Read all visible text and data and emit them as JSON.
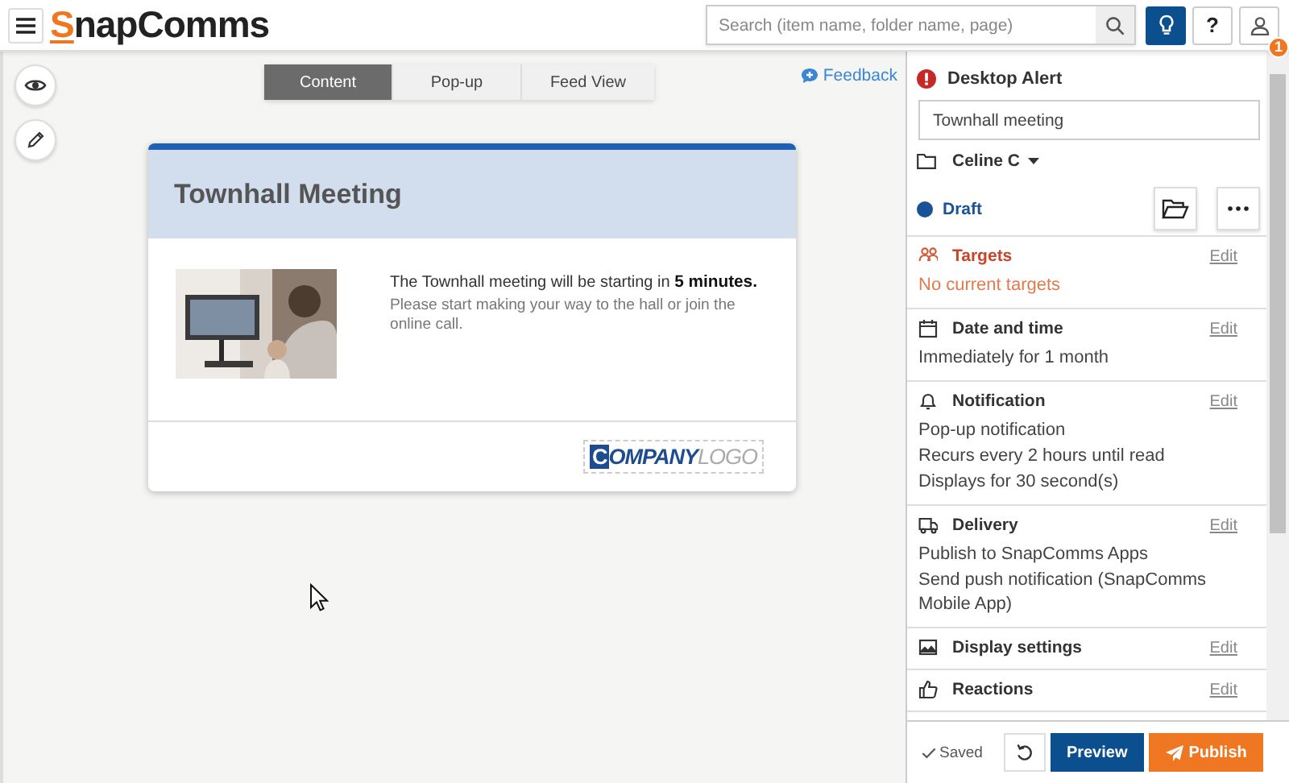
{
  "header": {
    "logo": "SnapComms",
    "search": {
      "placeholder": "Search (item name, folder name, page)"
    },
    "help": "?",
    "badge": "1"
  },
  "tabs": [
    {
      "label": "Content",
      "selected": true
    },
    {
      "label": "Pop-up",
      "selected": false
    },
    {
      "label": "Feed View",
      "selected": false
    }
  ],
  "feedback": "Feedback",
  "preview": {
    "title": "Townhall Meeting",
    "message": "The Townhall meeting will be starting in **5 minutes.**",
    "note": "Please start making your way to the hall or join the online call.",
    "logo_bold": "COMPANY",
    "logo_light": "LOGO"
  },
  "panel": {
    "type": "Desktop Alert",
    "name": "Townhall meeting",
    "owner": "Celine C",
    "status": {
      "label": "Draft",
      "color": "#1a5296"
    },
    "sections": [
      {
        "kind": "targets",
        "title": "Targets",
        "edit": "Edit",
        "warning": true,
        "lines": [
          "No current targets"
        ]
      },
      {
        "kind": "date",
        "title": "Date and time",
        "edit": "Edit",
        "warning": false,
        "lines": [
          "Immediately for 1 month"
        ]
      },
      {
        "kind": "notification",
        "title": "Notification",
        "edit": "Edit",
        "warning": false,
        "lines": [
          "Pop-up notification",
          "Recurs every 2 hours until read",
          "Displays for 30 second(s)"
        ]
      },
      {
        "kind": "delivery",
        "title": "Delivery",
        "edit": "Edit",
        "warning": false,
        "lines": [
          "Publish to SnapComms Apps",
          "Send push notification (SnapComms Mobile App)"
        ]
      },
      {
        "kind": "display",
        "title": "Display settings",
        "edit": "Edit",
        "warning": false
      },
      {
        "kind": "reactions",
        "title": "Reactions",
        "edit": "Edit",
        "warning": false
      }
    ],
    "footer": {
      "saved": "Saved",
      "preview": "Preview",
      "publish": "Publish"
    }
  }
}
